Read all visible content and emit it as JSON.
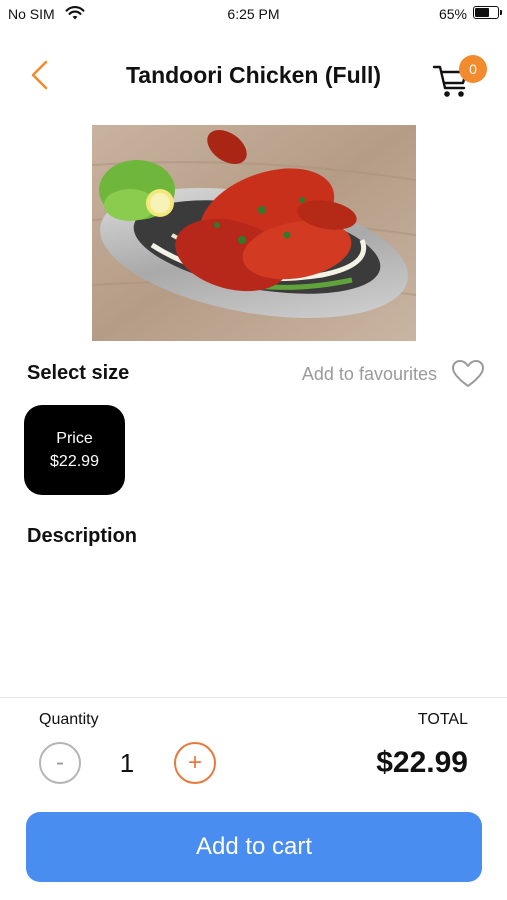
{
  "status_bar": {
    "carrier": "No SIM",
    "time": "6:25 PM",
    "battery_percent": "65%",
    "battery_level": 0.65
  },
  "header": {
    "title": "Tandoori Chicken (Full)",
    "cart_count": "0",
    "back_icon": "chevron-left-icon",
    "cart_icon": "cart-icon"
  },
  "product": {
    "image_subject": "Tandoori chicken on foil platter"
  },
  "size_section": {
    "heading": "Select size",
    "favourites_label": "Add to favourites",
    "favourites_icon": "heart-icon",
    "options": [
      {
        "name": "Price",
        "price": "$22.99"
      }
    ]
  },
  "description": {
    "heading": "Description"
  },
  "footer": {
    "quantity_label": "Quantity",
    "quantity_value": "1",
    "minus_symbol": "-",
    "plus_symbol": "+",
    "total_label": "TOTAL",
    "total_value": "$22.99",
    "add_to_cart_label": "Add to cart"
  },
  "colors": {
    "accent_orange": "#f28a2e",
    "primary_blue": "#4a8df0",
    "muted_gray": "#9a9a9a"
  }
}
